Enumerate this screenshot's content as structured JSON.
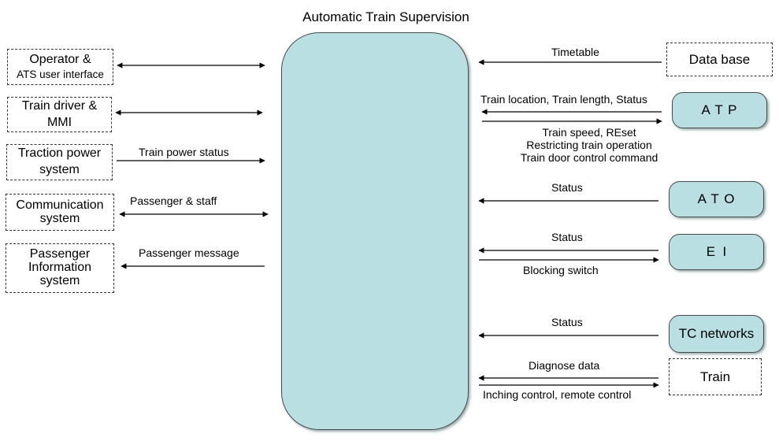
{
  "title": "Automatic Train Supervision",
  "colors": {
    "ats_fill": "#b9dfe2",
    "border": "#4a4a4a",
    "arrow": "#000000"
  },
  "left_systems": [
    {
      "id": "operator",
      "lines": [
        "Operator &",
        "ATS user interface"
      ],
      "arrow": "both",
      "label": ""
    },
    {
      "id": "train-driver",
      "lines": [
        "Train driver &",
        "MMI"
      ],
      "arrow": "both",
      "label": ""
    },
    {
      "id": "traction-power",
      "lines": [
        "Traction power",
        "system"
      ],
      "arrow": "to-ats",
      "label": "Train power status"
    },
    {
      "id": "communication",
      "lines": [
        "Communication",
        "system"
      ],
      "arrow": "both",
      "label": "Passenger & staff"
    },
    {
      "id": "passenger-info",
      "lines": [
        "Passenger",
        "Information",
        "system"
      ],
      "arrow": "from-ats",
      "label": "Passenger message"
    }
  ],
  "right_systems": [
    {
      "id": "database",
      "name": "Data base",
      "style": "dashed",
      "in_label": "Timetable",
      "out_label": ""
    },
    {
      "id": "atp",
      "name": "A T P",
      "style": "rounded",
      "in_label": "Train location, Train length, Status",
      "out_lines": [
        "Train speed, REset",
        "Restricting train operation",
        "Train door control command"
      ]
    },
    {
      "id": "ato",
      "name": "A T O",
      "style": "rounded",
      "in_label": "Status",
      "out_label": ""
    },
    {
      "id": "ei",
      "name": "E  I",
      "style": "rounded",
      "in_label": "Status",
      "out_label": "Blocking switch"
    },
    {
      "id": "tc-networks",
      "name": "TC networks",
      "style": "rounded",
      "in_label": "Status",
      "out_label": ""
    },
    {
      "id": "train",
      "name": "Train",
      "style": "dashed",
      "in_label": "Diagnose data",
      "out_label": "Inching control, remote control"
    }
  ]
}
